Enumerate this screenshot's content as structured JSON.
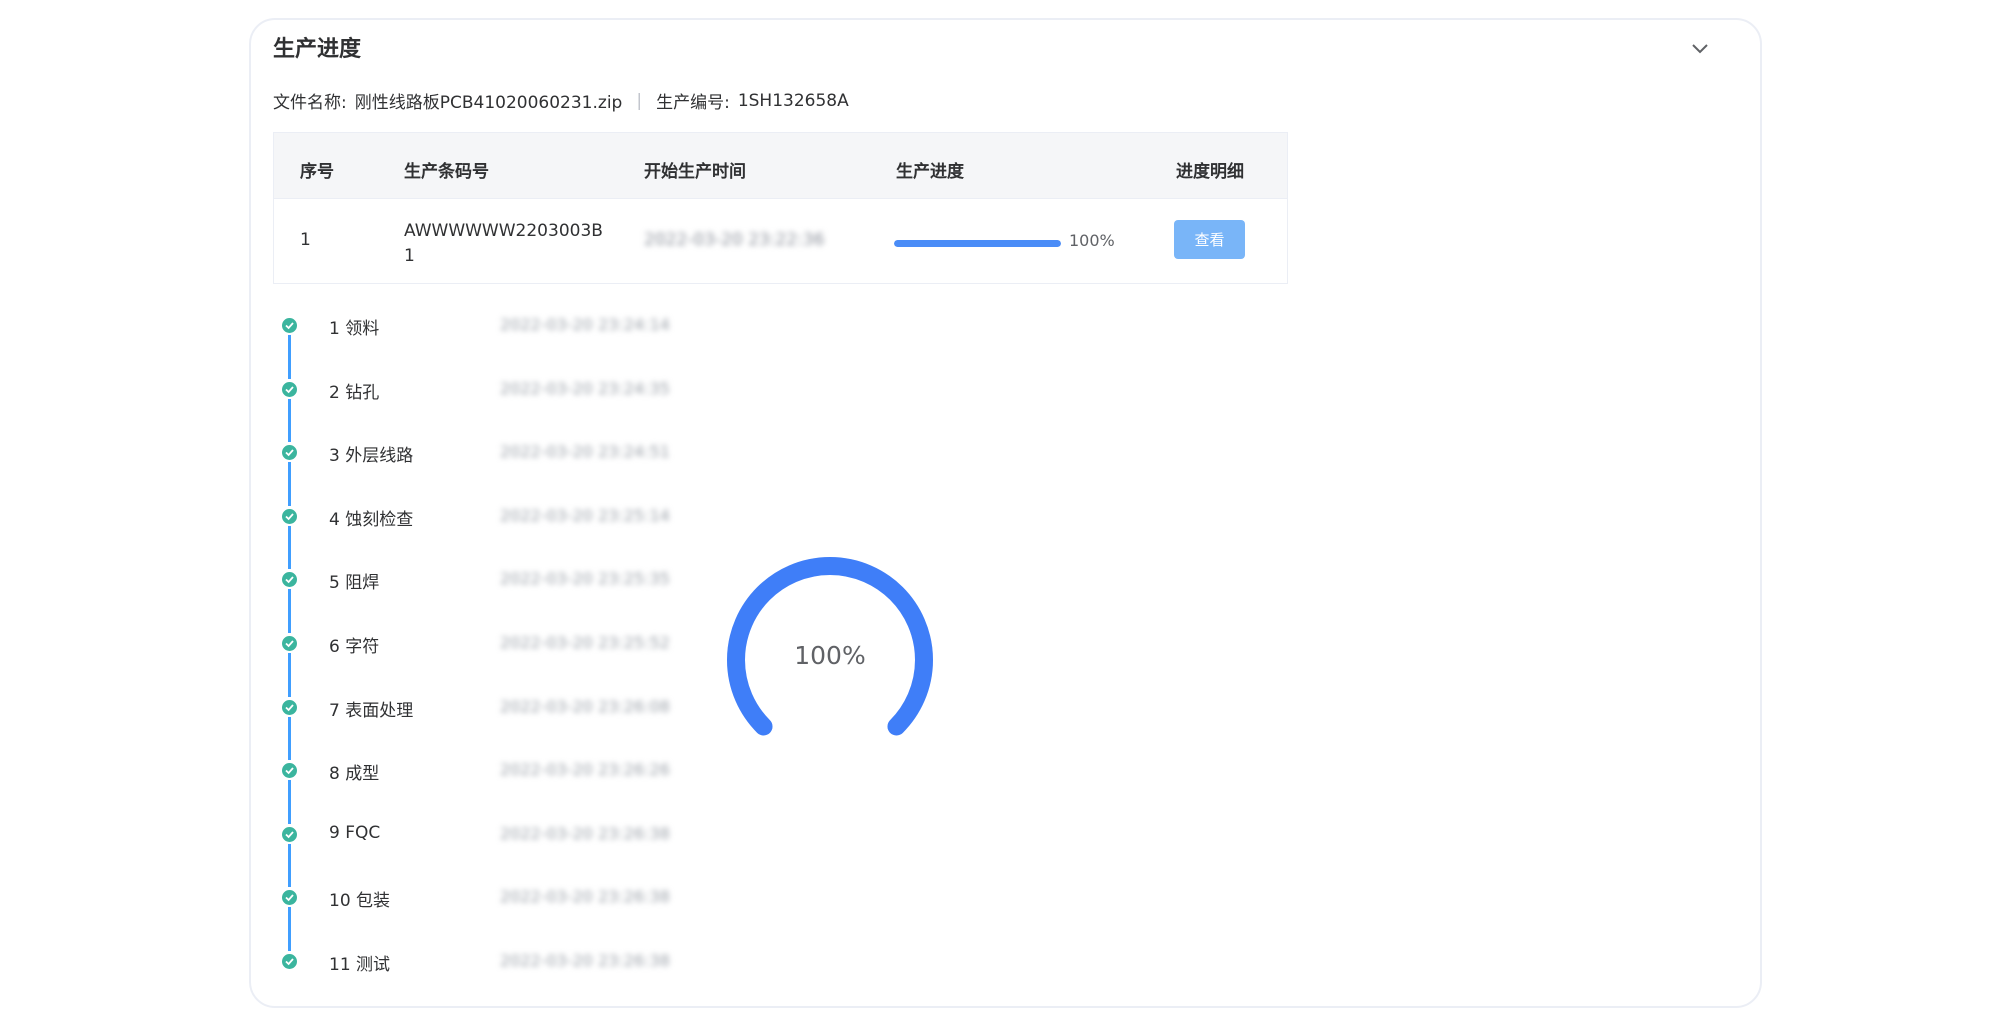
{
  "section": {
    "title": "生产进度"
  },
  "file_info": {
    "file_name_label": "文件名称:",
    "file_name": "刚性线路板PCB41020060231.zip",
    "separator": "|",
    "prod_no_label": "生产编号:",
    "prod_no": "1SH132658A"
  },
  "table": {
    "headers": [
      "序号",
      "生产条码号",
      "开始生产时间",
      "生产进度",
      "进度明细"
    ],
    "rows": [
      {
        "index": "1",
        "barcode": "AWWWWWW2203003B1",
        "start_time": "2022-03-20 23:22:36",
        "progress": 100,
        "progress_text": "100%",
        "action": "查看"
      }
    ]
  },
  "steps": [
    {
      "label": "1 领料",
      "time": "2022-03-20 23:24:14"
    },
    {
      "label": "2 钻孔",
      "time": "2022-03-20 23:24:35"
    },
    {
      "label": "3 外层线路",
      "time": "2022-03-20 23:24:51"
    },
    {
      "label": "4 蚀刻检查",
      "time": "2022-03-20 23:25:14"
    },
    {
      "label": "5 阻焊",
      "time": "2022-03-20 23:25:35"
    },
    {
      "label": "6 字符",
      "time": "2022-03-20 23:25:52"
    },
    {
      "label": "7 表面处理",
      "time": "2022-03-20 23:26:08"
    },
    {
      "label": "8 成型",
      "time": "2022-03-20 23:26:26"
    },
    {
      "label": "9 FQC",
      "time": "2022-03-20 23:26:38"
    },
    {
      "label": "10 包装",
      "time": "2022-03-20 23:26:38"
    },
    {
      "label": "11 测试",
      "time": "2022-03-20 23:26:38"
    }
  ],
  "gauge": {
    "value": 100,
    "text": "100%"
  },
  "colors": {
    "accent": "#3f7ef8",
    "step_done": "#3bb59e",
    "timeline_line": "#409eff",
    "button": "#79b5f8"
  },
  "icons": {
    "collapse": "chevron-down-icon",
    "step": "check-circle-icon"
  }
}
